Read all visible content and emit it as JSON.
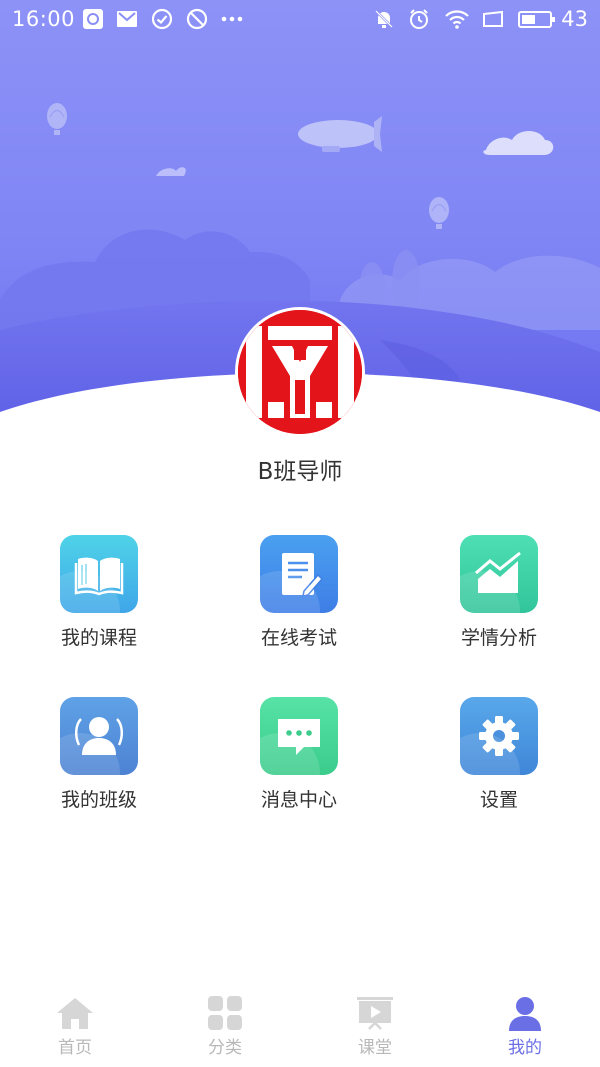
{
  "status_bar": {
    "time": "16:00",
    "battery_level": "43",
    "icons_left": [
      "app-notification-icon",
      "mail-notification-icon",
      "check-circle-icon",
      "block-icon",
      "more-dots-icon"
    ],
    "icons_right": [
      "mute-bell-icon",
      "alarm-icon",
      "wifi-icon",
      "screen-rotation-icon",
      "battery-icon"
    ]
  },
  "profile": {
    "name": "B班导师",
    "avatar": "school-logo-avatar"
  },
  "menu": [
    {
      "label": "我的课程",
      "icon": "book-icon",
      "color_top": "#4fd3e8",
      "color_bottom": "#3fa6e9"
    },
    {
      "label": "在线考试",
      "icon": "exam-paper-icon",
      "color_top": "#4aa0f0",
      "color_bottom": "#3e7ee6"
    },
    {
      "label": "学情分析",
      "icon": "trend-chart-icon",
      "color_top": "#4ee0b4",
      "color_bottom": "#32c49a"
    },
    {
      "label": "我的班级",
      "icon": "class-group-icon",
      "color_top": "#5fa2e6",
      "color_bottom": "#4d82d3"
    },
    {
      "label": "消息中心",
      "icon": "message-bubble-icon",
      "color_top": "#57e2a6",
      "color_bottom": "#3bcc8c"
    },
    {
      "label": "设置",
      "icon": "gear-icon",
      "color_top": "#59a8ea",
      "color_bottom": "#3f86d8"
    }
  ],
  "tabs": [
    {
      "label": "首页",
      "icon": "home-icon",
      "active": false
    },
    {
      "label": "分类",
      "icon": "category-grid-icon",
      "active": false
    },
    {
      "label": "课堂",
      "icon": "classroom-play-icon",
      "active": false
    },
    {
      "label": "我的",
      "icon": "profile-person-icon",
      "active": true
    }
  ],
  "colors": {
    "hero_top": "#8a8ff6",
    "hero_bottom": "#6d6ff0",
    "active_tab": "#6b6fe6",
    "inactive_tab": "#b8b8b8"
  }
}
